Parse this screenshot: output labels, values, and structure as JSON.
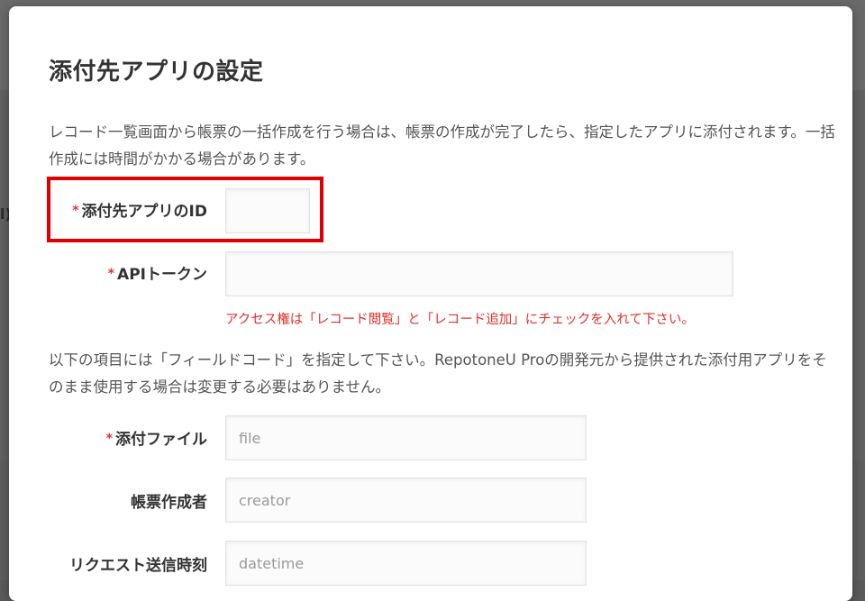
{
  "background": {
    "partial_text": "l)"
  },
  "dialog": {
    "title": "添付先アプリの設定",
    "description1": "レコード一覧画面から帳票の一括作成を行う場合は、帳票の作成が完了したら、指定したアプリに添付されます。一括作成には時間がかかる場合があります。",
    "description2": "以下の項目には「フィールドコード」を指定して下さい。RepotoneU Proの開発元から提供された添付用アプリをそのまま使用する場合は変更する必要はありません。",
    "required_mark": "*",
    "fields": {
      "app_id": {
        "label": "添付先アプリのID",
        "value": "",
        "required": true
      },
      "api_token": {
        "label": "APIトークン",
        "value": "",
        "required": true,
        "hint": "アクセス権は「レコード閲覧」と「レコード追加」にチェックを入れて下さい。"
      },
      "attachment": {
        "label": "添付ファイル",
        "placeholder": "file",
        "value": "",
        "required": true
      },
      "creator": {
        "label": "帳票作成者",
        "placeholder": "creator",
        "value": "",
        "required": false
      },
      "datetime": {
        "label": "リクエスト送信時刻",
        "placeholder": "datetime",
        "value": "",
        "required": false
      }
    }
  },
  "colors": {
    "required": "#e3312a",
    "highlight": "#e00000"
  }
}
